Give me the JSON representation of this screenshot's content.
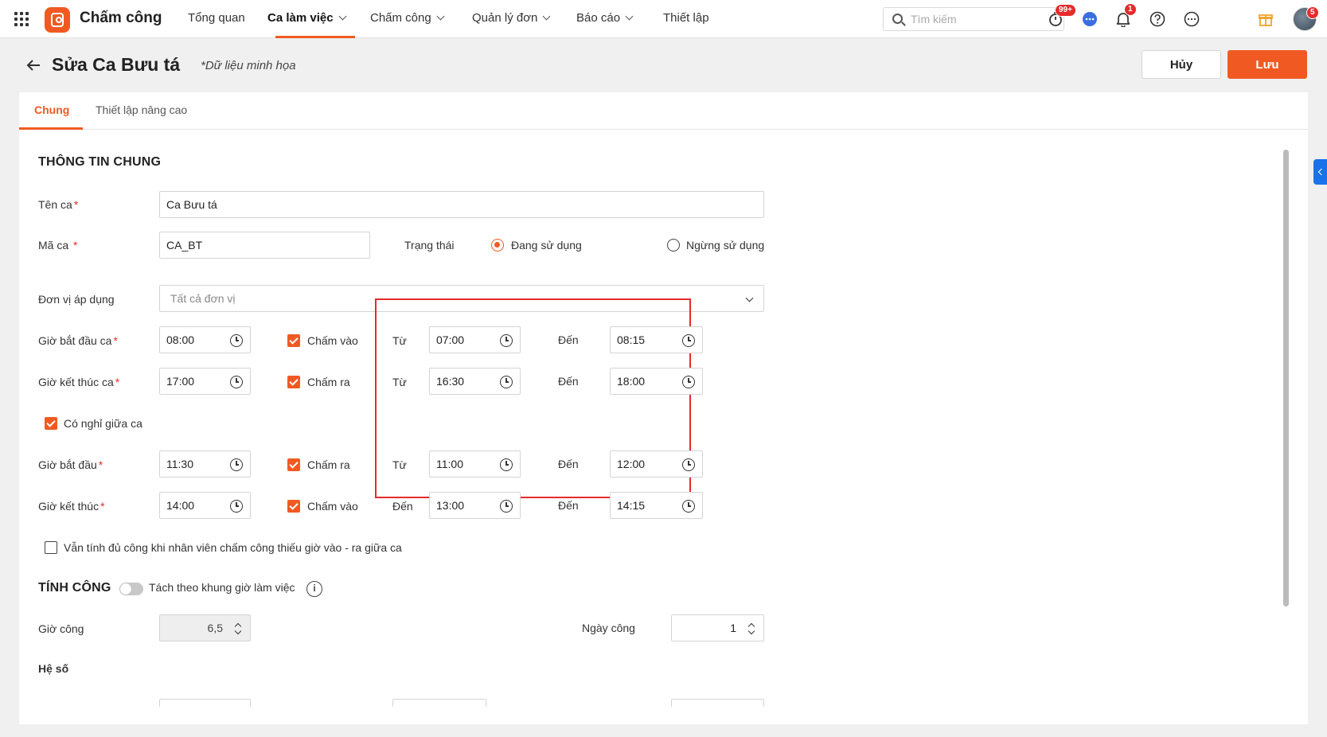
{
  "app": {
    "name": "Chấm công"
  },
  "nav": {
    "items": [
      {
        "label": "Tổng quan"
      },
      {
        "label": "Ca làm việc"
      },
      {
        "label": "Chấm công"
      },
      {
        "label": "Quản lý đơn"
      },
      {
        "label": "Báo cáo"
      },
      {
        "label": "Thiết lập"
      }
    ]
  },
  "search": {
    "placeholder": "Tìm kiếm"
  },
  "badges": {
    "timer": "99+",
    "notifications": "1",
    "avatar": "5"
  },
  "header": {
    "title": "Sửa Ca Bưu tá",
    "note": "*Dữ liệu minh họa",
    "cancel_label": "Hủy",
    "save_label": "Lưu"
  },
  "tabs": {
    "general": "Chung",
    "advanced": "Thiết lập nâng cao"
  },
  "general": {
    "section_title": "THÔNG TIN CHUNG",
    "shift_name": {
      "label": "Tên ca",
      "value": "Ca Bưu tá"
    },
    "shift_code": {
      "label": "Mã ca ",
      "value": "CA_BT"
    },
    "status": {
      "label": "Trạng thái",
      "active": "Đang sử dụng",
      "inactive": "Ngừng sử dụng",
      "selected": "Đang sử dụng"
    },
    "unit": {
      "label": "Đơn vị áp dụng",
      "placeholder": "Tất cả đơn vị"
    },
    "start": {
      "label": "Giờ bắt đầu ca",
      "value": "08:00",
      "check_label": "Chấm vào",
      "from_label": "Từ",
      "from": "07:00",
      "to_label": "Đến",
      "to": "08:15"
    },
    "end": {
      "label": "Giờ kết thúc ca",
      "value": "17:00",
      "check_label": "Chấm ra",
      "from_label": "Từ",
      "from": "16:30",
      "to_label": "Đến",
      "to": "18:00"
    },
    "break_label": "Có nghỉ giữa ca",
    "break_start": {
      "label": "Giờ bắt đầu",
      "value": "11:30",
      "check_label": "Chấm ra",
      "from_label": "Từ",
      "from": "11:00",
      "to_label": "Đến",
      "to": "12:00"
    },
    "break_end": {
      "label": "Giờ kết thúc",
      "value": "14:00",
      "check_label": "Chấm vào",
      "from_label": "Đến",
      "from": "13:00",
      "to_label": "Đến",
      "to": "14:15"
    },
    "full_credit_label": "Vẫn tính đủ công khi nhân viên chấm công thiếu giờ vào - ra giữa ca"
  },
  "work": {
    "section_title": "TÍNH CÔNG",
    "split_label": "Tách theo khung giờ làm việc",
    "hours_label": "Giờ công",
    "hours_value": "6,5",
    "days_label": "Ngày công",
    "days_value": "1",
    "coef_label": "Hệ số"
  }
}
